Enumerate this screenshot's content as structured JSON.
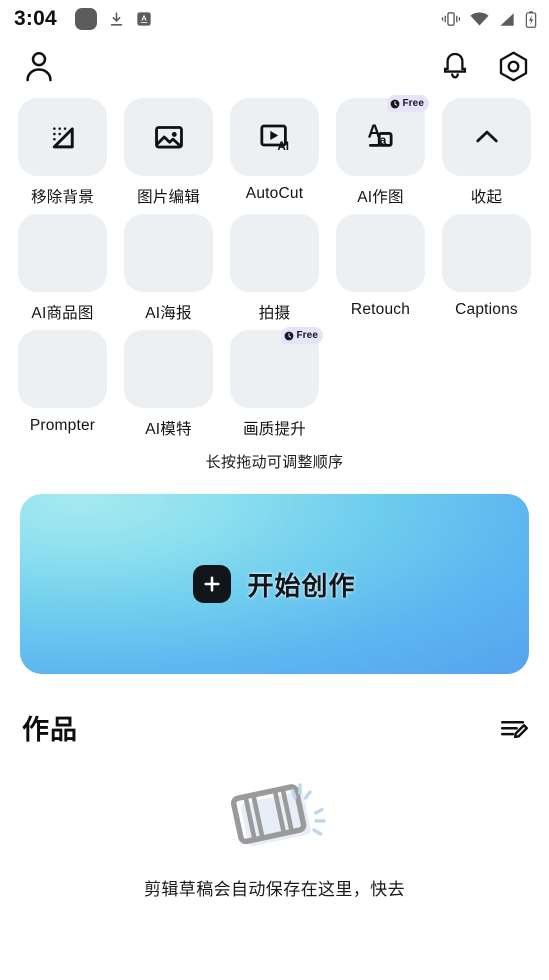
{
  "status_bar": {
    "time": "3:04",
    "left_icons": [
      "app-square-icon",
      "download-icon",
      "a-badge-icon"
    ],
    "right_icons": [
      "vibrate-icon",
      "wifi-icon",
      "signal-icon",
      "battery-charging-icon"
    ]
  },
  "app_bar": {
    "profile_icon": "person-icon",
    "notification_icon": "bell-icon",
    "settings_icon": "settings-hexagon-icon"
  },
  "tool_grid": {
    "rows": [
      [
        {
          "label": "移除背景",
          "icon": "remove-background-icon",
          "badge": null
        },
        {
          "label": "图片编辑",
          "icon": "image-edit-icon",
          "badge": null
        },
        {
          "label": "AutoCut",
          "icon": "autocut-video-ai-icon",
          "badge": null
        },
        {
          "label": "AI作图",
          "icon": "ai-text-image-icon",
          "badge": "Free"
        },
        {
          "label": "收起",
          "icon": "chevron-up-icon",
          "badge": null
        }
      ],
      [
        {
          "label": "AI商品图",
          "icon": "",
          "badge": null
        },
        {
          "label": "AI海报",
          "icon": "",
          "badge": null
        },
        {
          "label": "拍摄",
          "icon": "",
          "badge": null
        },
        {
          "label": "Retouch",
          "icon": "",
          "badge": null
        },
        {
          "label": "Captions",
          "icon": "",
          "badge": null
        }
      ],
      [
        {
          "label": "Prompter",
          "icon": "",
          "badge": null
        },
        {
          "label": "AI模特",
          "icon": "",
          "badge": null
        },
        {
          "label": "画质提升",
          "icon": "",
          "badge": "Free"
        }
      ]
    ],
    "hint": "长按拖动可调整顺序",
    "badge_clock_icon": "clock-icon"
  },
  "cta": {
    "label": "开始创作",
    "icon": "plus-icon",
    "gradient_from": "#a6e9ef",
    "gradient_to": "#56a6ef"
  },
  "works": {
    "title": "作品",
    "manage_icon": "edit-list-icon",
    "empty_illustration": "film-strip-icon",
    "empty_text": "剪辑草稿会自动保存在这里，快去"
  },
  "colors": {
    "tile_bg": "#ecf0f3",
    "badge_bg": "#e6e3fb",
    "text_primary": "#141414"
  }
}
